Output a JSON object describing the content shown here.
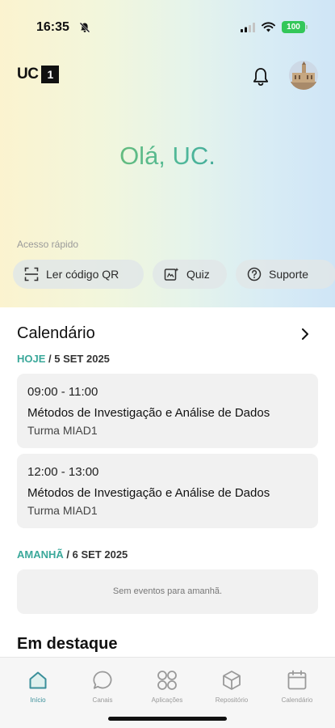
{
  "status_bar": {
    "time": "16:35",
    "battery": "100"
  },
  "header": {
    "logo_text": "UC",
    "logo_badge": "1"
  },
  "hero": {
    "greeting": "Olá, UC."
  },
  "quick_access": {
    "label": "Acesso rápido",
    "items": [
      {
        "label": "Ler código QR",
        "icon": "qr-scan-icon"
      },
      {
        "label": "Quiz",
        "icon": "quiz-icon"
      },
      {
        "label": "Suporte",
        "icon": "help-icon"
      }
    ]
  },
  "calendar": {
    "title": "Calendário",
    "today": {
      "prefix": "HOJE",
      "date": " / 5 SET 2025"
    },
    "events": [
      {
        "time": "09:00 - 11:00",
        "title": "Métodos de Investigação e Análise de Dados",
        "group": "Turma MIAD1"
      },
      {
        "time": "12:00 - 13:00",
        "title": "Métodos de Investigação e Análise de Dados",
        "group": "Turma MIAD1"
      }
    ],
    "tomorrow": {
      "prefix": "AMANHÃ",
      "date": " / 6 SET 2025",
      "empty": "Sem eventos para amanhã."
    }
  },
  "featured": {
    "title": "Em destaque"
  },
  "tabbar": {
    "items": [
      {
        "label": "Início",
        "icon": "home-icon",
        "active": true
      },
      {
        "label": "Canais",
        "icon": "chat-icon",
        "active": false
      },
      {
        "label": "Aplicações",
        "icon": "apps-icon",
        "active": false
      },
      {
        "label": "Repositório",
        "icon": "box-icon",
        "active": false
      },
      {
        "label": "Calendário",
        "icon": "calendar-icon",
        "active": false
      }
    ]
  },
  "colors": {
    "accent": "#3aa89a",
    "battery": "#33c759"
  }
}
